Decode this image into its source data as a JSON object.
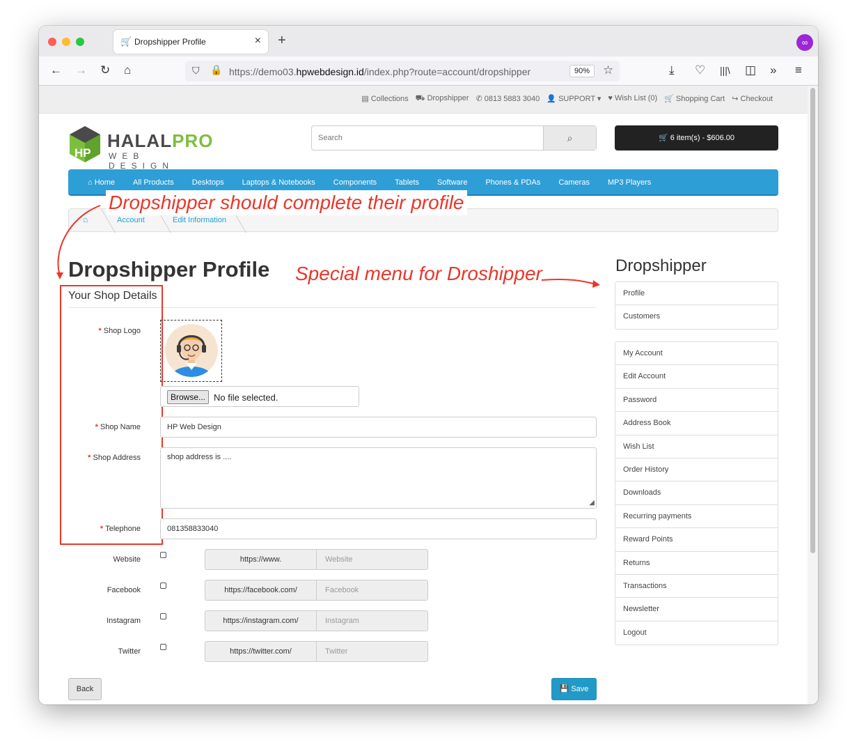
{
  "browser": {
    "tab_title": "Dropshipper Profile",
    "url_prefix": "https://demo03.",
    "url_domain": "hpwebdesign.id",
    "url_path": "/index.php?route=account/dropshipper",
    "zoom": "90%"
  },
  "toplinks": {
    "collections": "Collections",
    "dropshipper": "Dropshipper",
    "phone": "0813 5883 3040",
    "support": "SUPPORT",
    "wishlist": "Wish List (0)",
    "cart": "Shopping Cart",
    "checkout": "Checkout"
  },
  "logo": {
    "brand_a": "HALAL",
    "brand_b": "PRO",
    "sub": "WEB DESIGN"
  },
  "search": {
    "placeholder": "Search"
  },
  "cart_button": "6 item(s) - $606.00",
  "menu": [
    "Home",
    "All Products",
    "Desktops",
    "Laptops & Notebooks",
    "Components",
    "Tablets",
    "Software",
    "Phones & PDAs",
    "Cameras",
    "MP3 Players"
  ],
  "breadcrumb": {
    "c1": "Account",
    "c2": "Edit Information"
  },
  "annotations": {
    "a1": "Dropshipper should complete their profile",
    "a2": "Special menu for Droshipper"
  },
  "page_title": "Dropshipper Profile",
  "legend": "Your Shop Details",
  "form": {
    "shop_logo_label": "Shop Logo",
    "browse": "Browse...",
    "file_status": "No file selected.",
    "shop_name_label": "Shop Name",
    "shop_name_value": "HP Web Design",
    "shop_address_label": "Shop Address",
    "shop_address_value": "shop address is ....",
    "telephone_label": "Telephone",
    "telephone_value": "081358833040",
    "socials": [
      {
        "label": "Website",
        "prefix": "https://www.",
        "placeholder": "Website"
      },
      {
        "label": "Facebook",
        "prefix": "https://facebook.com/",
        "placeholder": "Facebook"
      },
      {
        "label": "Instagram",
        "prefix": "https://instagram.com/",
        "placeholder": "Instagram"
      },
      {
        "label": "Twitter",
        "prefix": "https://twitter.com/",
        "placeholder": "Twitter"
      }
    ],
    "back": "Back",
    "save": "Save"
  },
  "sidebar": {
    "title": "Dropshipper",
    "special": [
      "Profile",
      "Customers"
    ],
    "account": [
      "My Account",
      "Edit Account",
      "Password",
      "Address Book",
      "Wish List",
      "Order History",
      "Downloads",
      "Recurring payments",
      "Reward Points",
      "Returns",
      "Transactions",
      "Newsletter",
      "Logout"
    ]
  },
  "colors": {
    "accent": "#2e9ed6",
    "annotation": "#e8372a",
    "cart": "#222222",
    "save": "#229ac8"
  }
}
